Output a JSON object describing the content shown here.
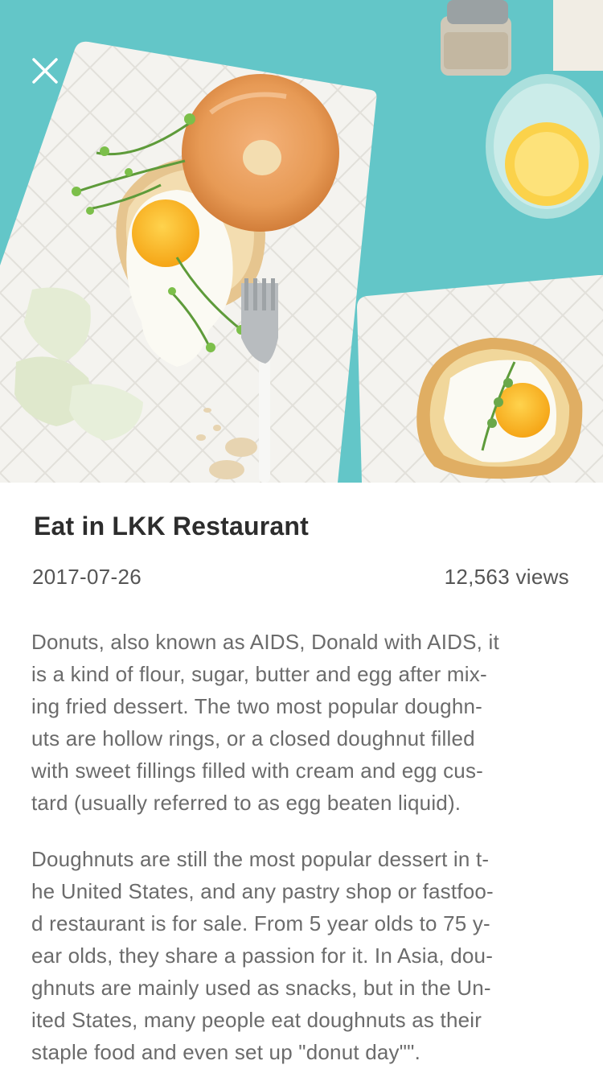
{
  "article": {
    "title": "Eat in LKK Restaurant",
    "date": "2017-07-26",
    "views": "12,563 views",
    "paragraph_1_lines": [
      "Donuts, also known as AIDS, Donald with AIDS, it",
      "is a kind of flour, sugar, butter and egg after mix-",
      "ing fried dessert. The two most popular doughn-",
      "uts are hollow rings, or a closed doughnut filled",
      "with sweet fillings filled with cream and egg cus-",
      "tard (usually referred to as egg beaten liquid)."
    ],
    "paragraph_2_lines": [
      "Doughnuts are still the most popular dessert in t-",
      "he United States, and any pastry shop or fastfoo-",
      "d restaurant is for sale. From 5 year olds to 75 y-",
      "ear olds, they share a passion for it. In Asia, dou-",
      "ghnuts are mainly used as snacks, but in the Un-",
      "ited States, many people eat doughnuts as their",
      "staple food and even set up \"donut day\"\"."
    ]
  },
  "icons": {
    "close": "close-icon"
  },
  "colors": {
    "hero_background": "#63c6c8",
    "title": "#2d2d2d",
    "body_text": "#6b6b6b"
  }
}
